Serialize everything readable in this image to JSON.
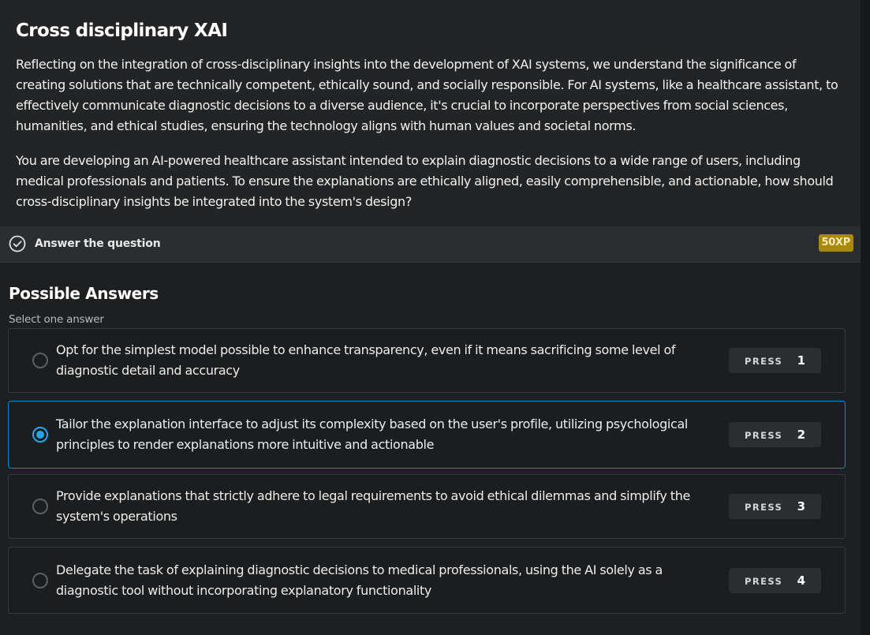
{
  "exercise": {
    "title": "Cross disciplinary XAI",
    "context_paragraph": "Reflecting on the integration of cross-disciplinary insights into the development of XAI systems, we understand the significance of creating solutions that are technically competent, ethically sound, and socially responsible. For AI systems, like a healthcare assistant, to effectively communicate diagnostic decisions to a diverse audience, it's crucial to incorporate perspectives from social sciences, humanities, and ethical studies, ensuring the technology aligns with human values and societal norms.",
    "question_paragraph": "You are developing an AI-powered healthcare assistant intended to explain diagnostic decisions to a wide range of users, including medical professionals and patients. To ensure the explanations are ethically aligned, easily comprehensible, and actionable, how should cross-disciplinary insights be integrated into the system's design?"
  },
  "task_bar": {
    "icon": "check-circle-icon",
    "label": "Answer the question",
    "xp": "50XP",
    "xp_color": "#a88a0e"
  },
  "answers": {
    "title": "Possible Answers",
    "instruction": "Select one answer",
    "selected_index": 2,
    "accent_color": "#22a8ea",
    "press_label": "PRESS",
    "options": [
      {
        "text": "Opt for the simplest model possible to enhance transparency, even if it means sacrificing some level of diagnostic detail and accuracy",
        "key": "1"
      },
      {
        "text": "Tailor the explanation interface to adjust its complexity based on the user's profile, utilizing psychological principles to render explanations more intuitive and actionable",
        "key": "2"
      },
      {
        "text": "Provide explanations that strictly adhere to legal requirements to avoid ethical dilemmas and simplify the system's operations",
        "key": "3"
      },
      {
        "text": "Delegate the task of explaining diagnostic decisions to medical professionals, using the AI solely as a diagnostic tool without incorporating explanatory functionality",
        "key": "4"
      }
    ]
  }
}
